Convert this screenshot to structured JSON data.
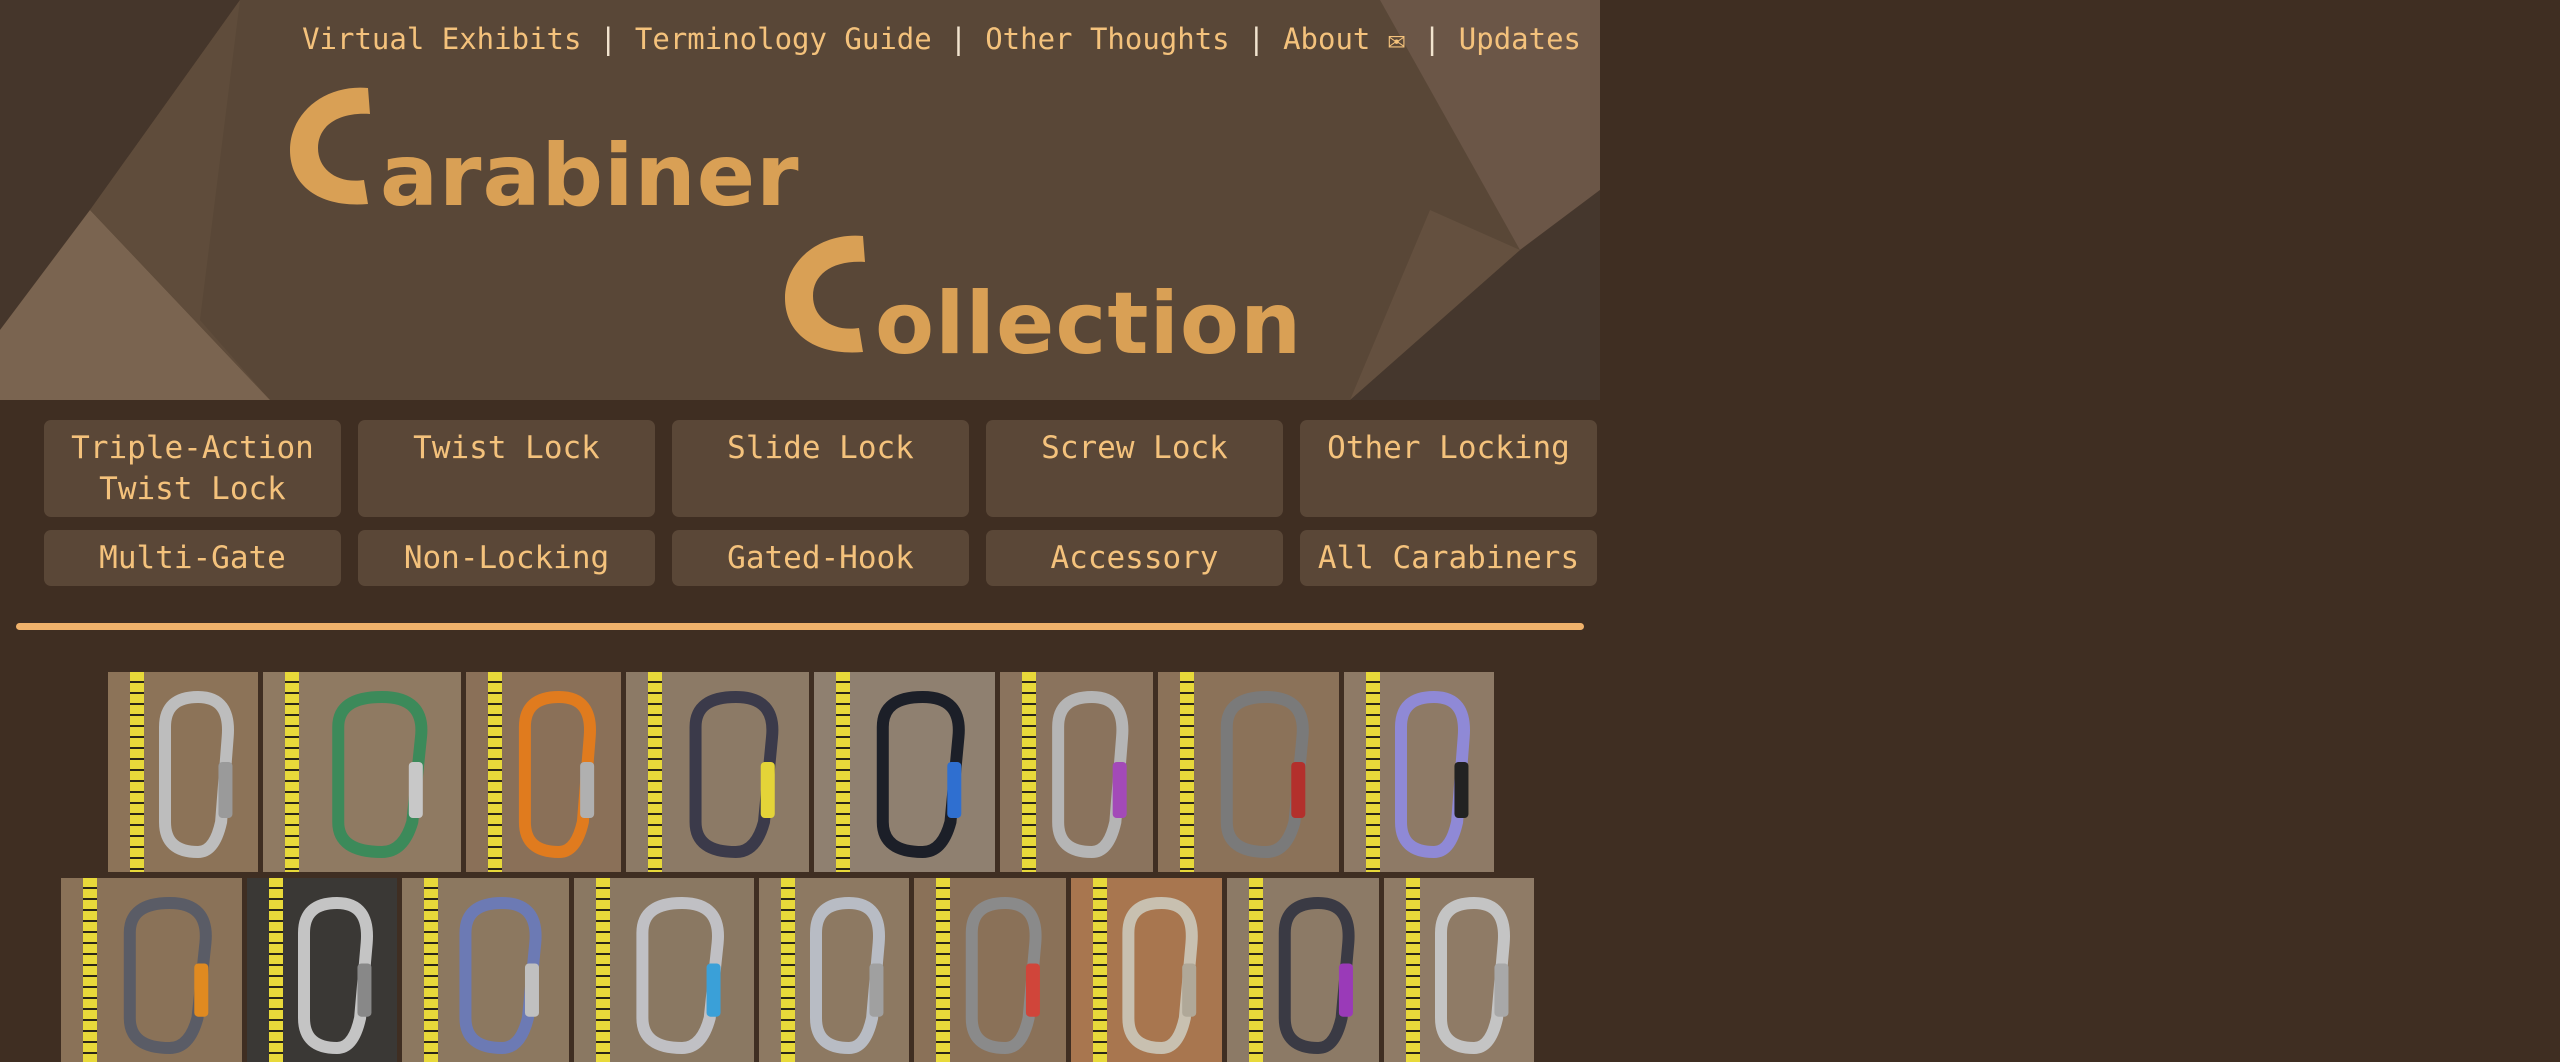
{
  "nav": {
    "items": [
      {
        "label": "Virtual Exhibits"
      },
      {
        "label": "Terminology Guide"
      },
      {
        "label": "Other Thoughts"
      },
      {
        "label": "About ✉"
      },
      {
        "label": "Updates"
      }
    ],
    "separator": "|"
  },
  "logo": {
    "line1_rest": "arabiner",
    "line2_rest": "ollection",
    "accent_color": "#d9a055"
  },
  "categories": [
    {
      "label": "Triple-Action Twist Lock"
    },
    {
      "label": "Twist Lock"
    },
    {
      "label": "Slide Lock"
    },
    {
      "label": "Screw Lock"
    },
    {
      "label": "Other Locking"
    },
    {
      "label": "Multi-Gate"
    },
    {
      "label": "Non-Locking"
    },
    {
      "label": "Gated-Hook"
    },
    {
      "label": "Accessory"
    },
    {
      "label": "All Carabiners"
    }
  ],
  "colors": {
    "page_bg": "#3f2e22",
    "header_bg": "#594737",
    "link": "#f4c27c",
    "button_bg": "#5a4737",
    "rule": "#f0b26b"
  },
  "gallery": {
    "row1": [
      {
        "name": "silver-d-carabiner",
        "bg": "#8c7358",
        "body": "#bdbdbd",
        "gate": "#9a9a9a"
      },
      {
        "name": "green-multi-hole-carabiner",
        "bg": "#8f7a62",
        "body": "#3c8a5a",
        "gate": "#c8c8c8"
      },
      {
        "name": "orange-carabiner",
        "bg": "#8a7058",
        "body": "#e07b1e",
        "gate": "#b0b0b0"
      },
      {
        "name": "dark-screwgate-carabiner",
        "bg": "#8c7a66",
        "body": "#3b3a4a",
        "gate": "#e4d438"
      },
      {
        "name": "black-blue-carabiner",
        "bg": "#8f8070",
        "body": "#1c1f28",
        "gate": "#2f6fd0"
      },
      {
        "name": "silver-purple-carabiner",
        "bg": "#8a735d",
        "body": "#b5b5b5",
        "gate": "#a34ab8"
      },
      {
        "name": "grey-red-double-carabiner",
        "bg": "#8b7259",
        "body": "#7a7a7a",
        "gate": "#b3302c"
      },
      {
        "name": "lavender-carabiner",
        "bg": "#8e7a66",
        "body": "#8f89d6",
        "gate": "#222222"
      }
    ],
    "row2": [
      {
        "name": "grey-orange-carabiner",
        "bg": "#8a7258",
        "body": "#5a5c66",
        "gate": "#e08a20"
      },
      {
        "name": "silver-screwgate-dark-bg",
        "bg": "#3a3835",
        "body": "#c4c4c4",
        "gate": "#888888"
      },
      {
        "name": "blue-grey-carabiner",
        "bg": "#8c7860",
        "body": "#6c7ab4",
        "gate": "#c0c0c0"
      },
      {
        "name": "silver-blue-pear-carabiner",
        "bg": "#8a7862",
        "body": "#c0c0c4",
        "gate": "#3aa0d8"
      },
      {
        "name": "light-silver-carabiner",
        "bg": "#8d7962",
        "body": "#b8bcc4",
        "gate": "#a0a0a0"
      },
      {
        "name": "grey-red-carabiner",
        "bg": "#8a7158",
        "body": "#8a8a8a",
        "gate": "#d0453a"
      },
      {
        "name": "oval-silver-carabiner",
        "bg": "#a8764f",
        "body": "#c8c0b0",
        "gate": "#b0a898"
      },
      {
        "name": "black-purple-carabiner",
        "bg": "#8c7a66",
        "body": "#3a3a44",
        "gate": "#9a3ab8"
      },
      {
        "name": "silver-small-carabiner",
        "bg": "#8f7b66",
        "body": "#c4c4c4",
        "gate": "#a8a8a8"
      }
    ]
  }
}
